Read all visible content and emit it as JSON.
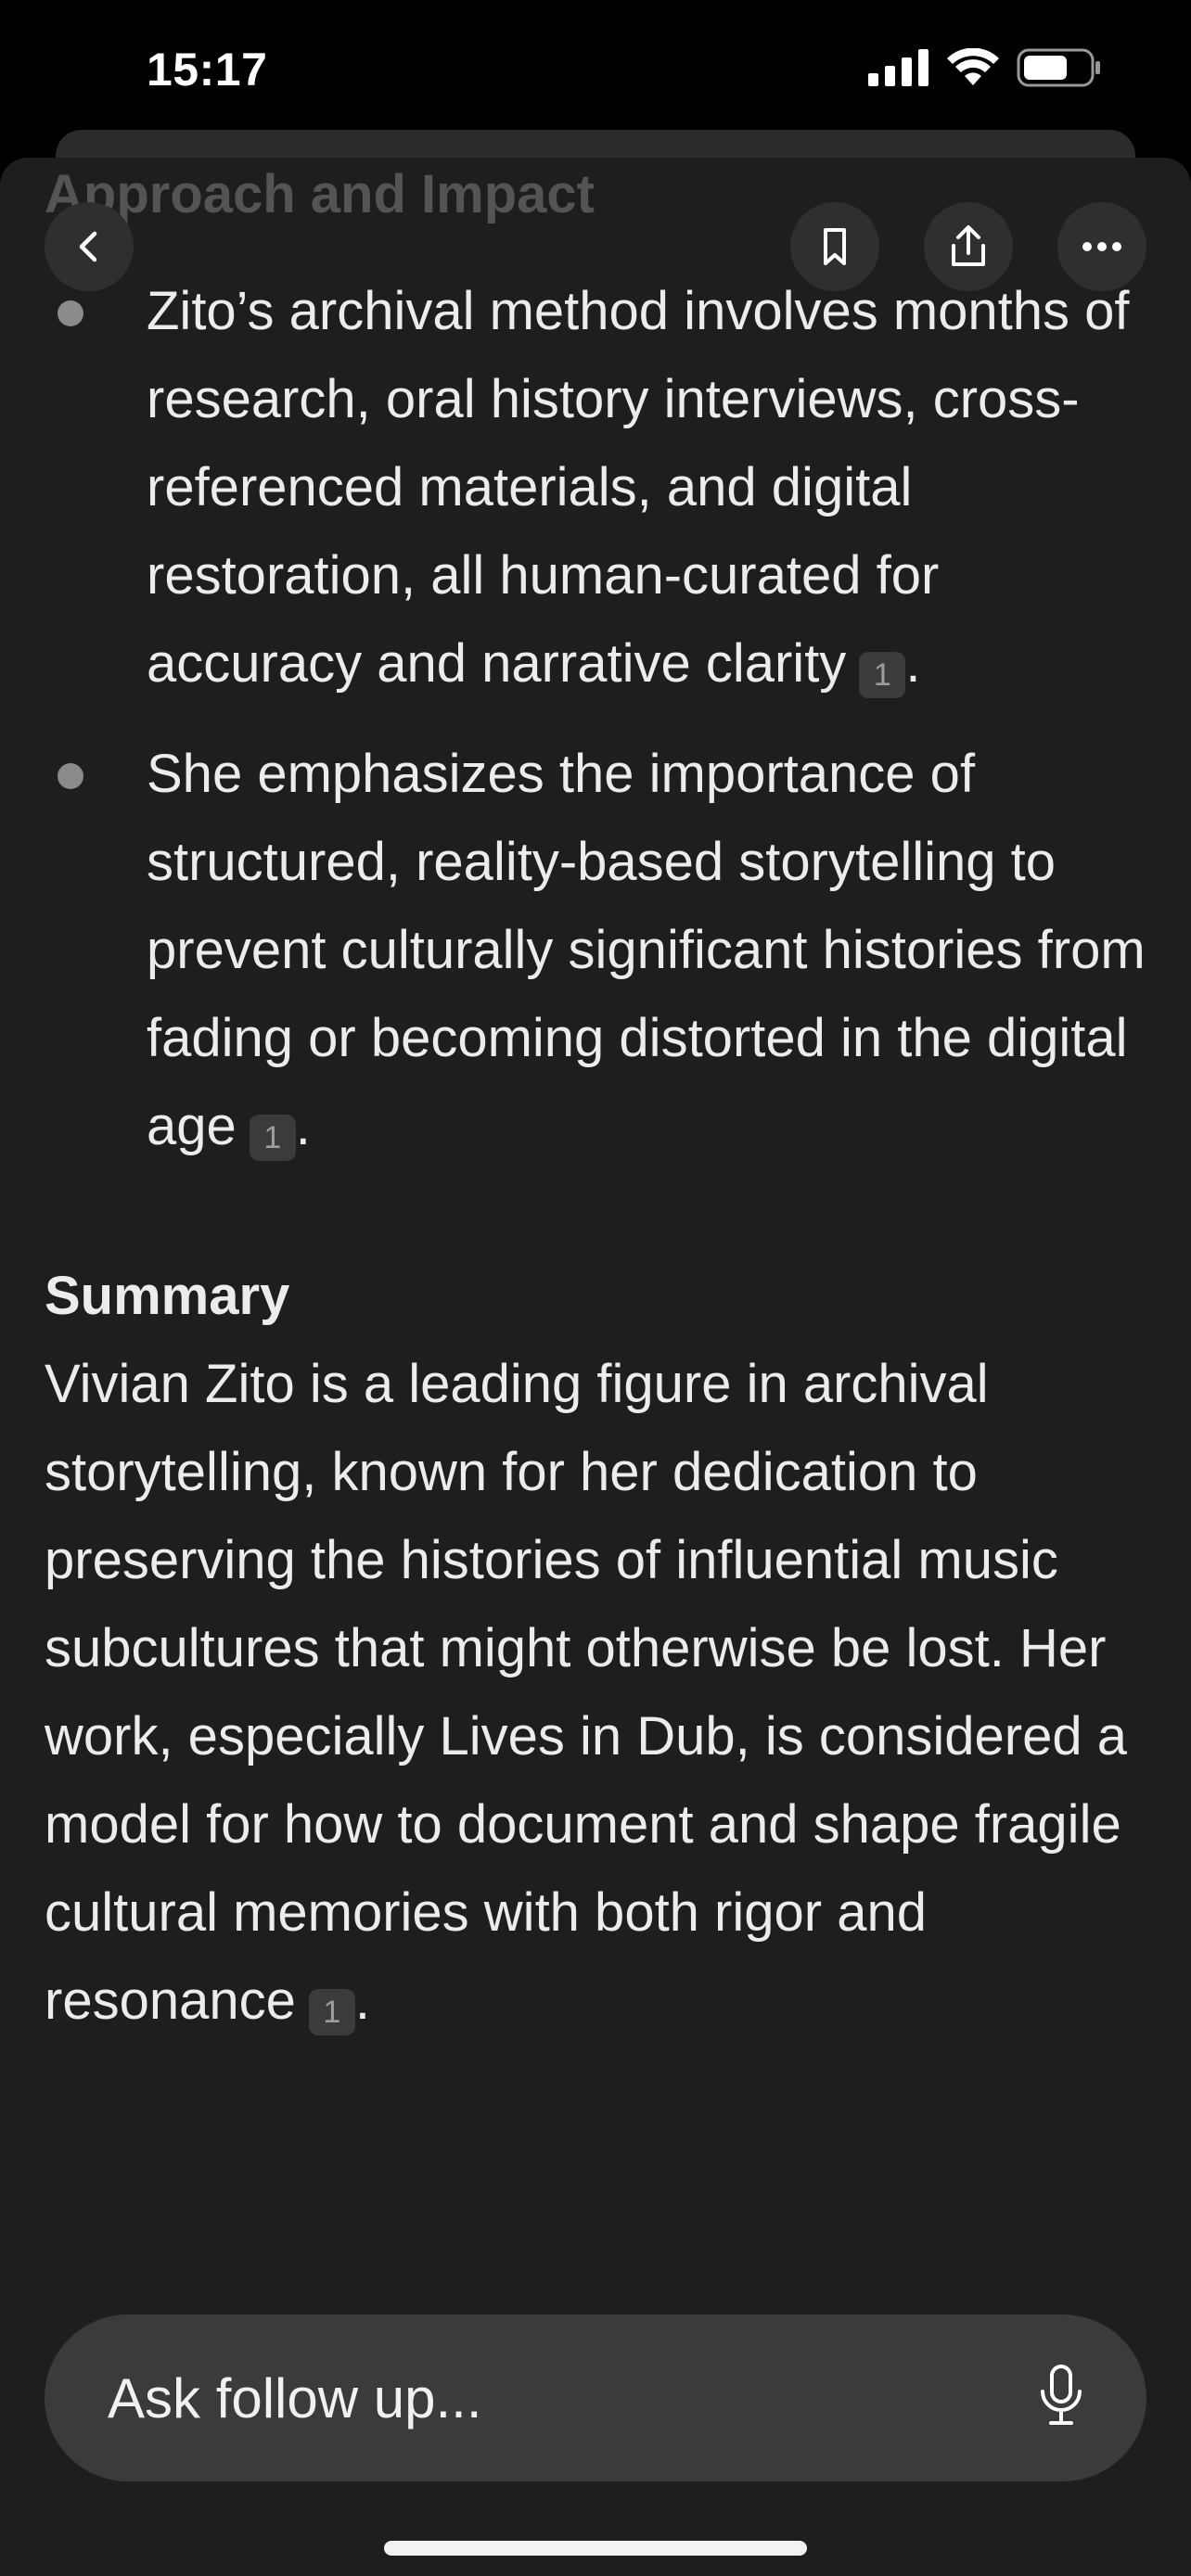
{
  "status_bar": {
    "time": "15:17",
    "signal_icon": "cellular-signal-icon",
    "wifi_icon": "wifi-icon",
    "battery_icon": "battery-icon"
  },
  "header": {
    "faded_section_title": "Approach and Impact",
    "back_icon": "chevron-left-icon",
    "bookmark_icon": "bookmark-icon",
    "share_icon": "share-icon",
    "more_icon": "ellipsis-icon"
  },
  "content": {
    "bullets": [
      {
        "text": "Zito’s archival method involves months of research, oral history interviews, cross-referenced materials, and digital restoration, all human-curated for accuracy and narrative clarity",
        "citation": "1",
        "end": "."
      },
      {
        "text": "She emphasizes the importance of structured, reality-based storytelling to prevent culturally significant histories from fading or becoming distorted in the digital age",
        "citation": "1",
        "end": "."
      }
    ],
    "summary_heading": "Summary",
    "summary_text": "Vivian Zito is a leading figure in archival storytelling, known for her dedication to preserving the histories of influential music subcultures that might otherwise be lost. Her work, especially Lives in Dub, is considered a model for how to document and shape fragile cultural memories with both rigor and resonance",
    "summary_citation": "1",
    "summary_end": "."
  },
  "followup": {
    "placeholder": "Ask follow up...",
    "mic_icon": "microphone-icon"
  },
  "colors": {
    "background": "#1d1e1f",
    "input_bg": "#3a3b3d",
    "text": "#ececec"
  }
}
